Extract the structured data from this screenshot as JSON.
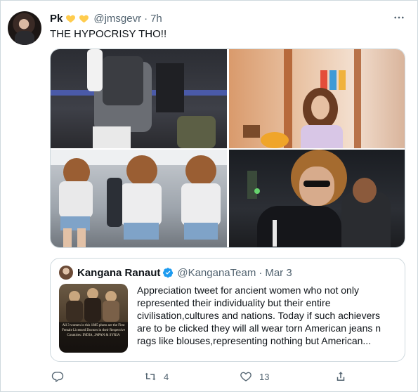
{
  "tweet": {
    "author_name": "Pk",
    "author_handle": "@jmsgevr",
    "separator": "·",
    "time": "7h",
    "text": "THE HYPOCRISY THO!!",
    "heart_color": "#ffcc4d"
  },
  "media": {
    "image_count": 4
  },
  "quoted_tweet": {
    "author_name": "Kangana Ranaut",
    "author_handle": "@KanganaTeam",
    "separator": "·",
    "date": "Mar 3",
    "thumbnail_caption": "All 3 women in this 1885 photo are the First Female Licensed Doctors in their Respective Countries: INDIA, JAPAN & SYRIA",
    "text": "Appreciation tweet for ancient women who not only represented their individuality but their entire civilisation,cultures and nations. Today if such achievers are to be clicked they will all wear torn American jeans n rags like blouses,representing nothing but American..."
  },
  "actions": {
    "reply_count": "",
    "retweet_count": "4",
    "like_count": "13",
    "share_count": ""
  },
  "colors": {
    "text": "#0f1419",
    "secondary": "#536471",
    "border": "#cfd9de",
    "verified": "#1d9bf0"
  },
  "icons": [
    "more-icon",
    "heart-emoji-icon",
    "verified-icon",
    "reply-icon",
    "retweet-icon",
    "like-icon",
    "share-icon"
  ]
}
